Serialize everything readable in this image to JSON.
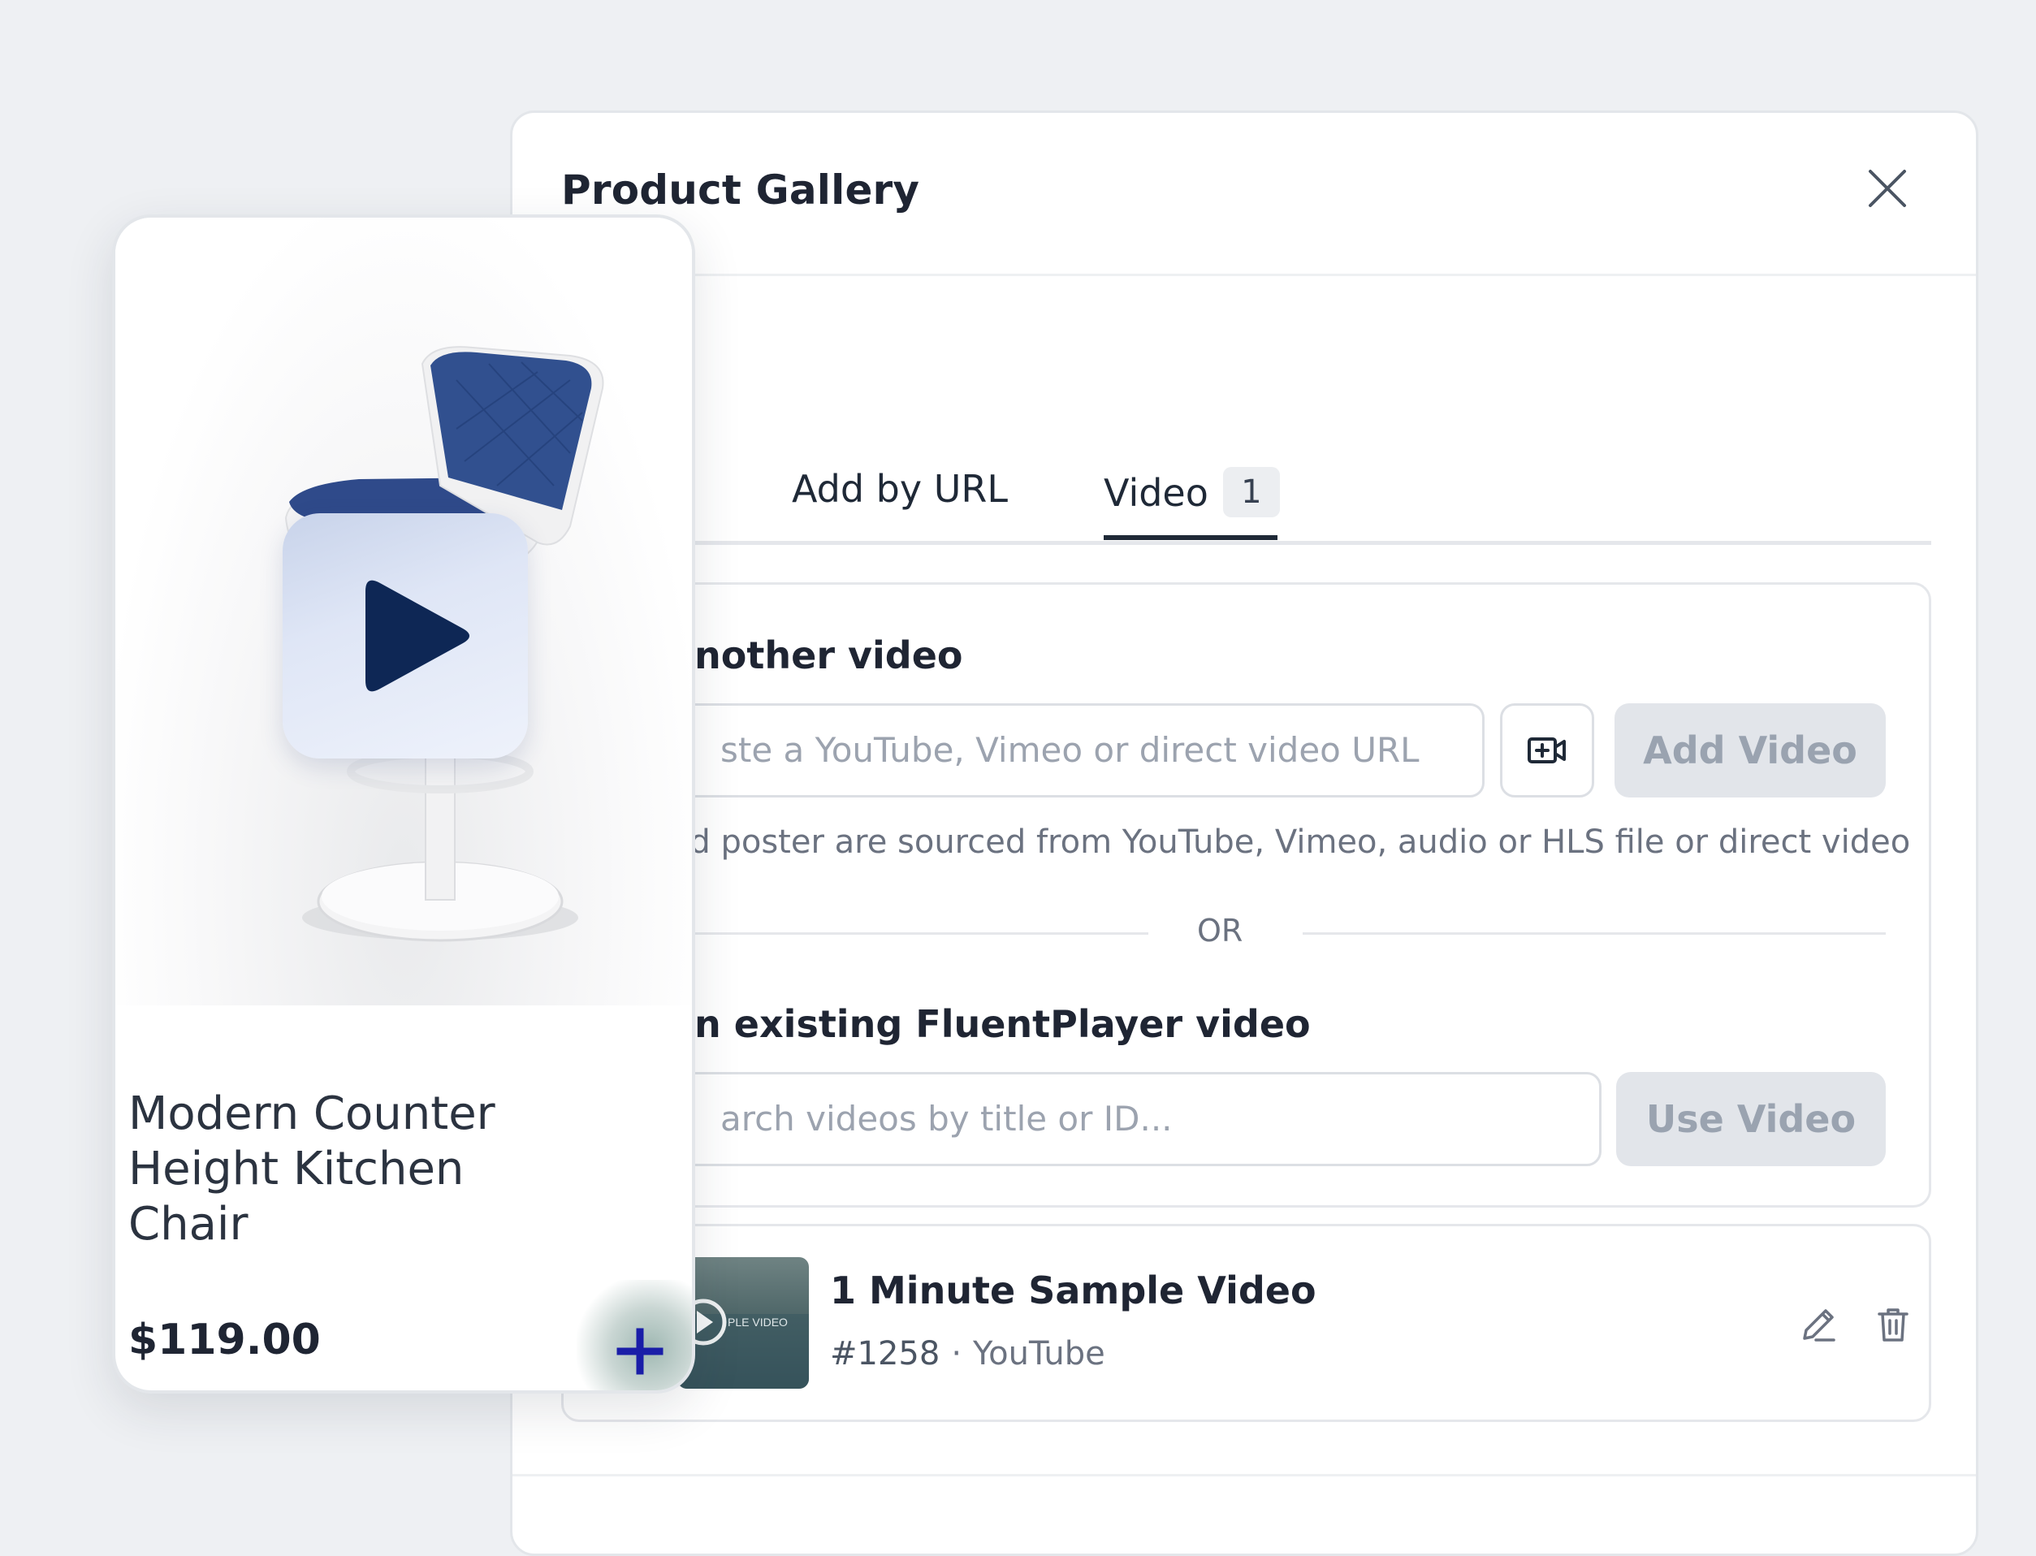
{
  "modal": {
    "title": "Product Gallery",
    "tabs": [
      {
        "label": "Add by URL"
      },
      {
        "label": "Video",
        "count": "1"
      }
    ],
    "add_section": {
      "label": "another video",
      "url_placeholder": "ste a YouTube, Vimeo or direct video URL",
      "add_button": "Add Video",
      "help": "nd poster are sourced from YouTube, Vimeo, audio or HLS file or direct video"
    },
    "divider": "OR",
    "existing_section": {
      "label": "an existing FluentPlayer video",
      "search_placeholder": "arch videos by title or ID...",
      "use_button": "Use Video"
    },
    "video_item": {
      "title": "1 Minute Sample Video",
      "id": "#1258",
      "source": "YouTube",
      "thumb_text": "PLE VIDEO"
    }
  },
  "product": {
    "name_lines": [
      "Modern Counter",
      "Height Kitchen",
      "Chair"
    ],
    "price": "$119.00"
  },
  "colors": {
    "play_icon": "#0e2755",
    "add_icon": "#1a1ea8",
    "chair_seat": "#2f4a8a"
  }
}
